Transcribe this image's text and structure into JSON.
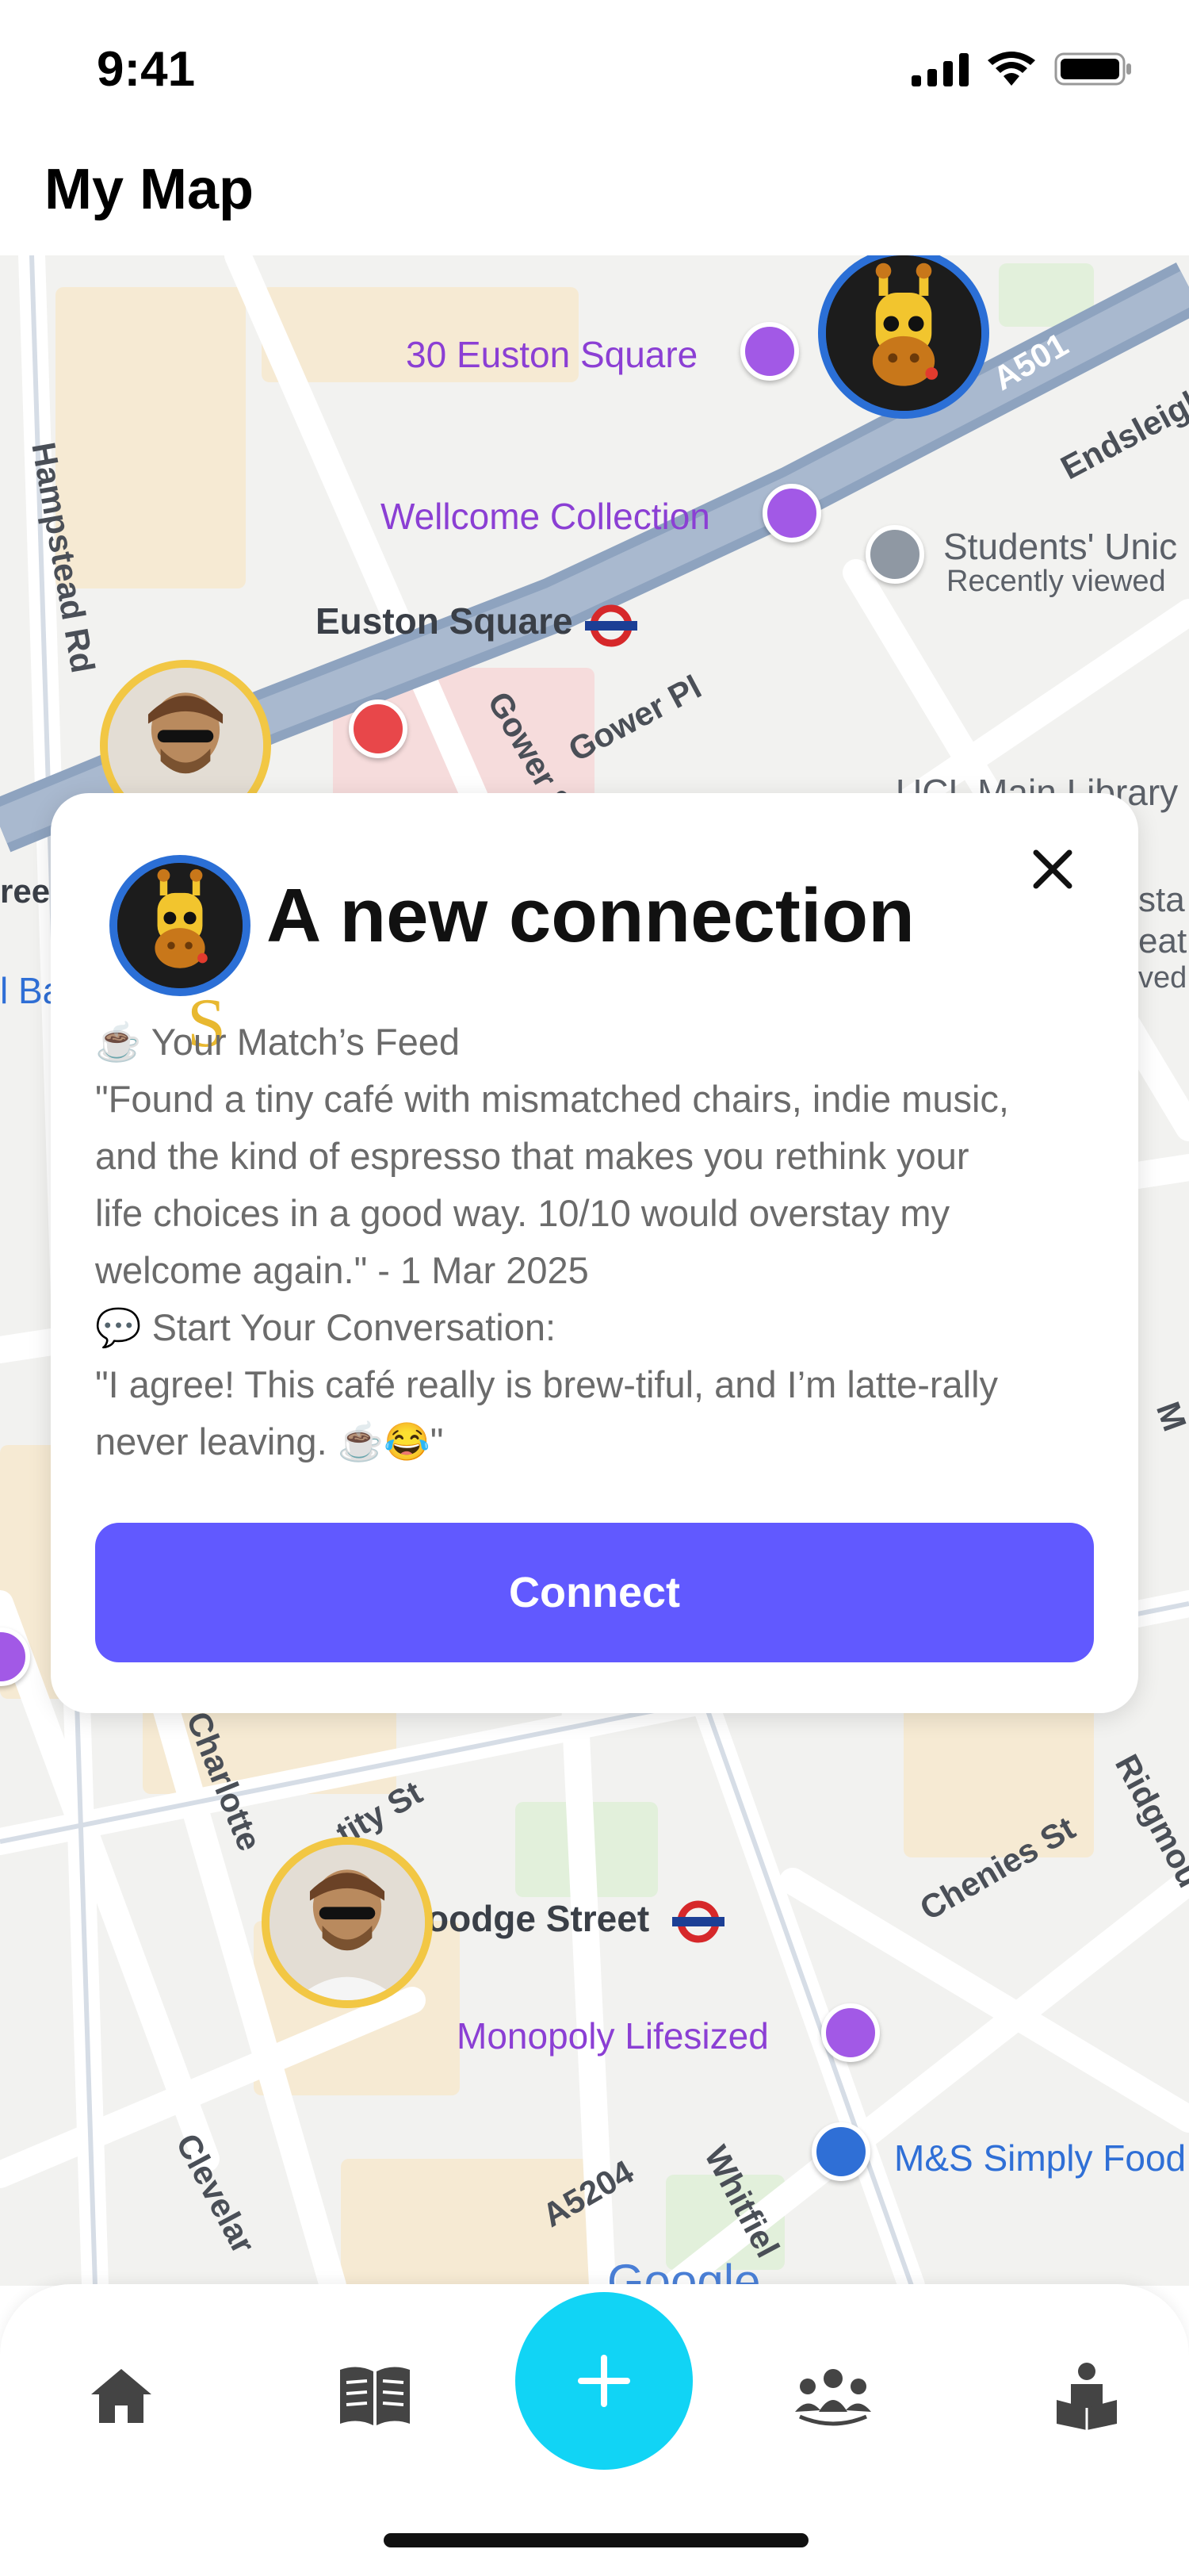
{
  "status_bar": {
    "time": "9:41"
  },
  "header": {
    "title": "My Map"
  },
  "map": {
    "labels": {
      "euston_square_30": "30 Euston Square",
      "wellcome": "Wellcome Collection",
      "students_union": "Students' Unic",
      "recently_viewed": "Recently viewed",
      "euston_square_station": "Euston Square",
      "hampstead_rd": "Hampstead Rd",
      "gower_st": "Gower St",
      "gower_pl": "Gower Pl",
      "ucl_library": "UCL Main Library",
      "a501": "A501",
      "endsleigh": "Endsleigh",
      "goodge_street": "oodge Street",
      "monopoly": "Monopoly Lifesized",
      "ms_food": "M&S Simply Food",
      "chenies_st": "Chenies St",
      "ridgmount": "Ridgmou",
      "charlotte": "Charlotte",
      "tity_st": "tity St",
      "a5204": "A5204",
      "whitfield": "Whitfiel",
      "cleveland": "Clevelar",
      "google": "Google",
      "left_edge_1": "ree",
      "left_edge_2": "l Ba",
      "right_edge_1": "sta",
      "right_edge_2": "eat",
      "right_edge_3": "ved",
      "right_edge_4": "M"
    }
  },
  "modal": {
    "title": "A new connection",
    "decor_letter": "S",
    "feed_heading": "☕ Your Match’s Feed",
    "feed_lines": [
      "\"Found a tiny café with mismatched chairs, indie music,",
      "and the kind of espresso that makes you rethink your",
      "life choices in a good way. 10/10 would overstay my",
      "welcome again.\" - 1 Mar 2025"
    ],
    "conversation_heading": "💬 Start Your Conversation:",
    "conversation_lines": [
      "\"I agree! This café really is brew-tiful, and I’m latte-rally",
      "never leaving. ☕😂\""
    ],
    "connect_label": "Connect"
  },
  "nav": {
    "items": [
      {
        "icon": "home-icon"
      },
      {
        "icon": "book-icon"
      },
      {
        "icon": "plus-icon"
      },
      {
        "icon": "group-icon"
      },
      {
        "icon": "reader-icon"
      }
    ]
  },
  "colors": {
    "accent": "#6159ff",
    "fab": "#11d4f5",
    "poi_purple": "#8b3fd4",
    "avatar_ring_blue": "#2b6fd6",
    "avatar_ring_yellow": "#f2c744"
  }
}
